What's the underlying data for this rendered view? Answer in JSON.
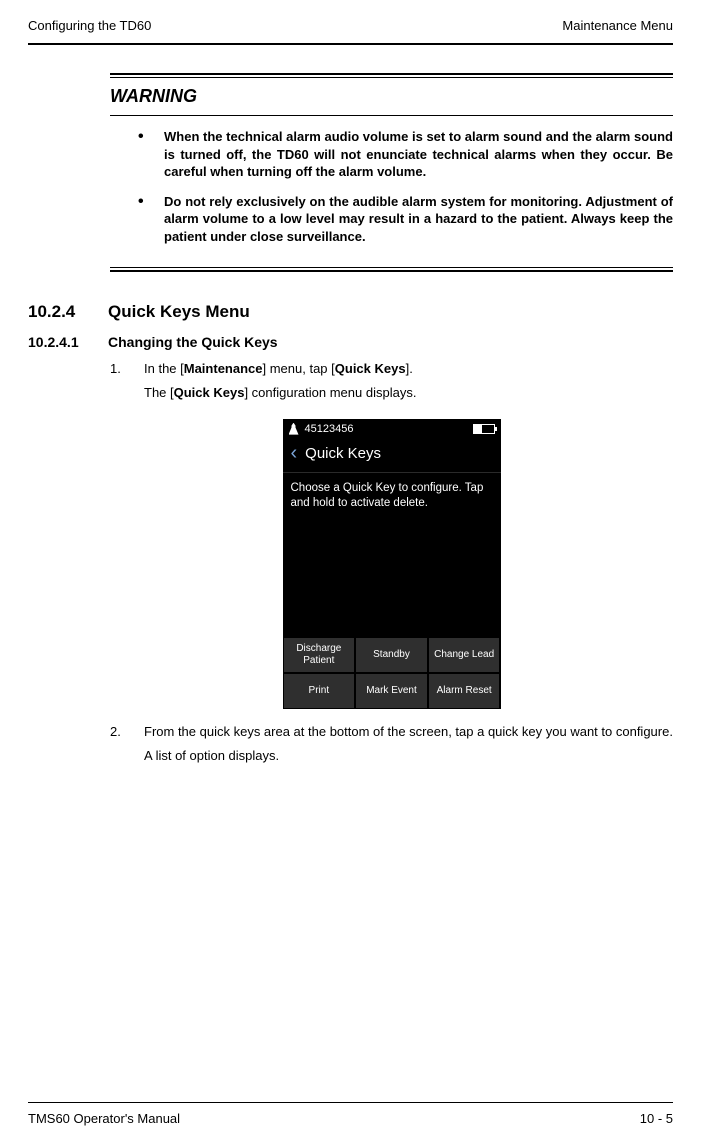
{
  "header": {
    "left": "Configuring the TD60",
    "right": "Maintenance Menu"
  },
  "warning": {
    "title": "WARNING",
    "items": [
      "When the technical alarm audio volume is set to alarm sound and the alarm sound is turned off, the TD60 will not enunciate technical alarms when they occur. Be careful when turning off the alarm volume.",
      "Do not rely exclusively on the audible alarm system for monitoring. Adjustment of alarm volume to a low level may result in a hazard to the patient. Always keep the patient under close surveillance."
    ]
  },
  "section": {
    "num": "10.2.4",
    "title": "Quick Keys Menu"
  },
  "subsection": {
    "num": "10.2.4.1",
    "title": "Changing the Quick Keys"
  },
  "steps": {
    "s1": {
      "num": "1.",
      "p1a": "In the [",
      "p1b": "Maintenance",
      "p1c": "] menu, tap [",
      "p1d": "Quick Keys",
      "p1e": "].",
      "p2a": "The [",
      "p2b": "Quick Keys",
      "p2c": "] configuration menu displays."
    },
    "s2": {
      "num": "2.",
      "p1": "From the quick keys area at the bottom of the screen, tap a quick key you want to configure.",
      "p2": "A list of option displays."
    }
  },
  "device": {
    "id": "45123456",
    "title": "Quick Keys",
    "instruction": "Choose a Quick Key to configure. Tap and hold to activate delete.",
    "keys": {
      "r1c1": "Discharge Patient",
      "r1c2": "Standby",
      "r1c3": "Change Lead",
      "r2c1": "Print",
      "r2c2": "Mark Event",
      "r2c3": "Alarm Reset"
    }
  },
  "footer": {
    "left": "TMS60 Operator's Manual",
    "right": "10 - 5"
  }
}
